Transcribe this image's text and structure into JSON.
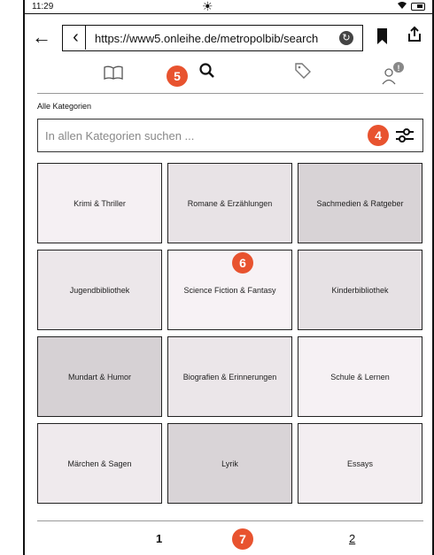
{
  "statusbar": {
    "time": "11:29",
    "sun_icon": "☀"
  },
  "browser": {
    "back_icon": "←",
    "url_back_icon": "‹",
    "url": "https://www5.onleihe.de/metropolbib/search",
    "reload_icon": "↻",
    "share_icon": "⭳"
  },
  "navtabs": {
    "book_icon": "📖",
    "search_icon": "⚲",
    "tag_icon": "🏷",
    "account_icon": "👤"
  },
  "badges": {
    "b5": "5",
    "b4": "4",
    "b6": "6",
    "b7": "7"
  },
  "search": {
    "category_label": "Alle Kategorien",
    "placeholder": "In allen Kategorien suchen ..."
  },
  "categories": [
    {
      "label": "Krimi & Thriller",
      "shade": "#f5f0f3"
    },
    {
      "label": "Romane & Erzählungen",
      "shade": "#e8e3e6"
    },
    {
      "label": "Sachmedien & Ratgeber",
      "shade": "#d8d3d6"
    },
    {
      "label": "Jugendbibliothek",
      "shade": "#ece7ea"
    },
    {
      "label": "Science Fiction & Fantasy",
      "shade": "#f7f2f5"
    },
    {
      "label": "Kinderbibliothek",
      "shade": "#e6e1e4"
    },
    {
      "label": "Mundart & Humor",
      "shade": "#d6d1d4"
    },
    {
      "label": "Biografien & Erinnerungen",
      "shade": "#ebe6e9"
    },
    {
      "label": "Schule & Lernen",
      "shade": "#f6f1f4"
    },
    {
      "label": "Märchen & Sagen",
      "shade": "#efeaed"
    },
    {
      "label": "Lyrik",
      "shade": "#d9d4d7"
    },
    {
      "label": "Essays",
      "shade": "#f3eef1"
    }
  ],
  "pager": {
    "page1": "1",
    "page2": "2"
  },
  "colors": {
    "badge": "#e8532f"
  }
}
